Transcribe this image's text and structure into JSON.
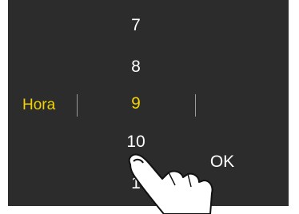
{
  "picker": {
    "label": "Hora",
    "values": [
      "7",
      "8",
      "9",
      "10",
      "1"
    ],
    "selected": "9"
  },
  "actions": {
    "ok_label": "OK"
  },
  "colors": {
    "background": "#2c2c2c",
    "selected": "#f2d300",
    "text": "#ffffff"
  }
}
